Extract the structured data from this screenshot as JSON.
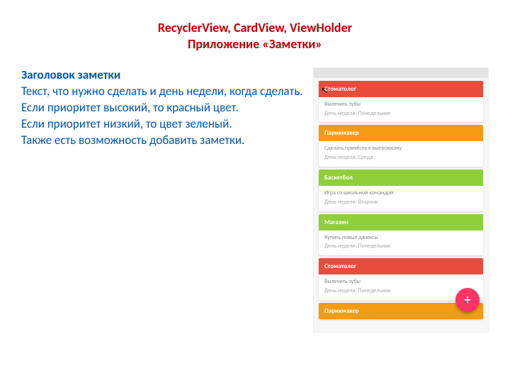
{
  "title": {
    "line1": "RecyclerView, CardView, ViewHolder",
    "line2": "Приложение «Заметки»"
  },
  "description": {
    "heading": "Заголовок заметки",
    "p1": "Текст, что нужно сделать и день недели, когда сделать.",
    "p2": "Если приоритет высокий, то красный цвет.",
    "p3": "Если приоритет низкий, то цвет зеленый.",
    "p4": "Также есть возможность добавить заметки."
  },
  "notes": [
    {
      "color": "red",
      "title": "Стоматолог",
      "task": "Вылечить зубы",
      "day": "День недели: Понедельник"
    },
    {
      "color": "orange",
      "title": "Парикмахер",
      "task": "Сделать причёску к выпускному",
      "day": "День недели: Среда"
    },
    {
      "color": "green",
      "title": "Баскетбол",
      "task": "Игра со школьной командой",
      "day": "День недели: Вторник"
    },
    {
      "color": "green",
      "title": "Магазин",
      "task": "Купить новые джинсы",
      "day": "День недели: Понедельник"
    },
    {
      "color": "red",
      "title": "Стоматолог",
      "task": "Вылечить зубы",
      "day": "День недели: Понедельник"
    },
    {
      "color": "orange",
      "title": "Парикмахер",
      "task": "",
      "day": ""
    }
  ],
  "fab": {
    "glyph": "+"
  }
}
